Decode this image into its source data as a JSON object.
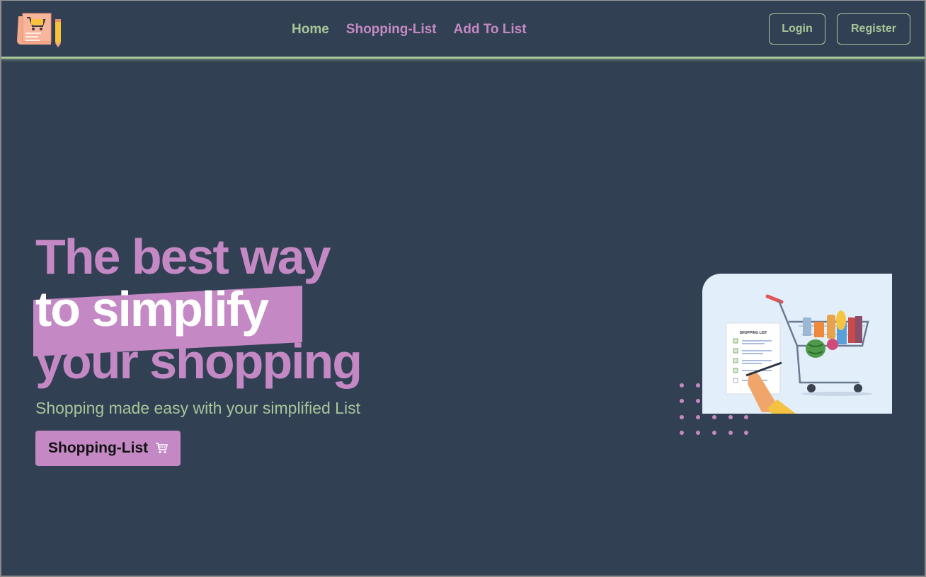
{
  "nav": {
    "links": [
      {
        "label": "Home"
      },
      {
        "label": "Shopping-List"
      },
      {
        "label": "Add To List"
      }
    ],
    "login_label": "Login",
    "register_label": "Register"
  },
  "hero": {
    "line1": "The best way",
    "line2": "to simplify",
    "line3": "your shopping",
    "subtitle": "Shopping made easy with your simplified List",
    "cta_label": "Shopping-List",
    "cta_icon": "cart-icon"
  },
  "illustration": {
    "list_title": "SHOPPING LIST"
  },
  "colors": {
    "background": "#324053",
    "accent_purple": "#c489c4",
    "accent_green": "#a7c79a",
    "text_white": "#ffffff"
  }
}
